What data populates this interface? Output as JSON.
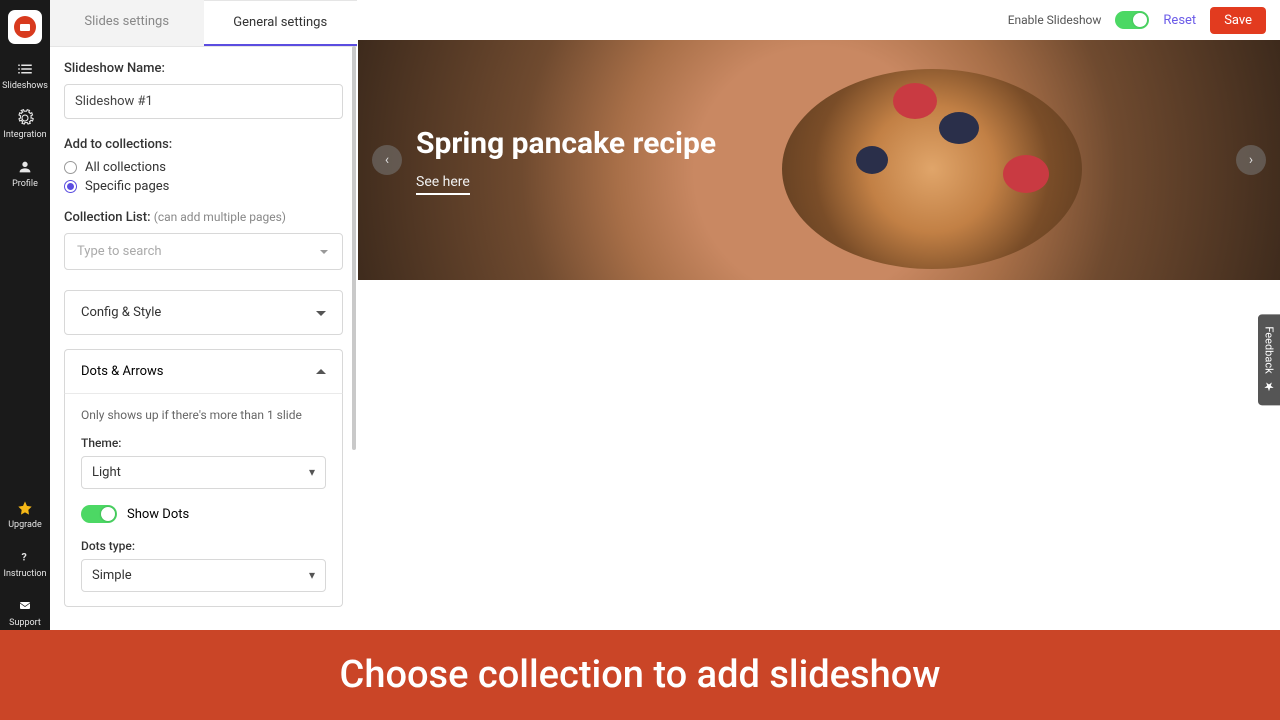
{
  "sidebar": {
    "items": [
      {
        "label": "Slideshows"
      },
      {
        "label": "Integration"
      },
      {
        "label": "Profile"
      }
    ],
    "bottom": [
      {
        "label": "Upgrade"
      },
      {
        "label": "Instruction"
      },
      {
        "label": "Support"
      }
    ]
  },
  "tabs": {
    "slides": "Slides settings",
    "general": "General settings"
  },
  "form": {
    "name_label": "Slideshow Name:",
    "name_value": "Slideshow #1",
    "collections_label": "Add to collections:",
    "opt_all": "All collections",
    "opt_specific": "Specific pages",
    "list_label": "Collection List:",
    "list_hint": "(can add multiple pages)",
    "list_placeholder": "Type to search",
    "config_section": "Config & Style",
    "dots_section": "Dots & Arrows",
    "dots_note": "Only shows up if there's more than 1 slide",
    "theme_label": "Theme:",
    "theme_value": "Light",
    "show_dots": "Show Dots",
    "dots_type_label": "Dots type:",
    "dots_type_value": "Simple"
  },
  "topbar": {
    "enable": "Enable Slideshow",
    "reset": "Reset",
    "save": "Save"
  },
  "hero": {
    "title": "Spring pancake recipe",
    "link": "See here"
  },
  "feedback": "Feedback",
  "banner": "Choose collection to add slideshow"
}
